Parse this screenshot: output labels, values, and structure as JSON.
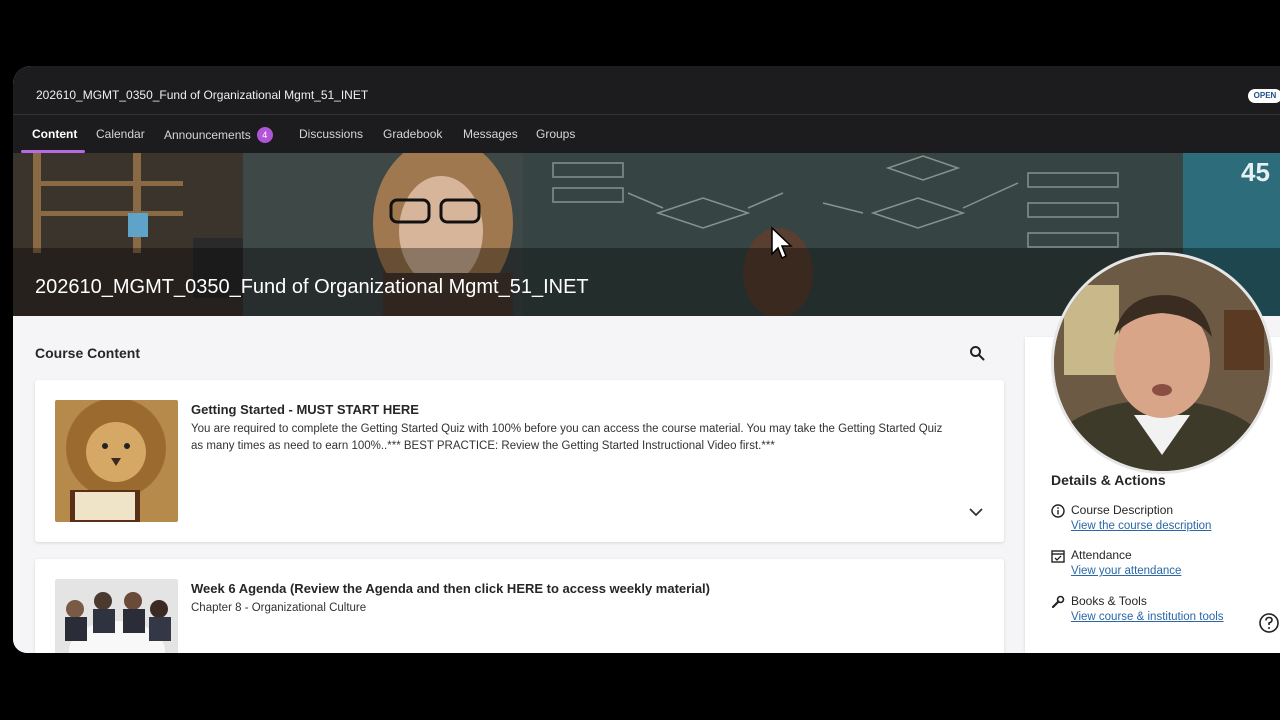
{
  "course": {
    "code": "202610_MGMT_0350_Fund of Organizational Mgmt_51_INET",
    "status_badge": "OPEN",
    "banner_title": "202610_MGMT_0350_Fund of Organizational Mgmt_51_INET"
  },
  "nav": {
    "tabs": [
      {
        "label": "Content",
        "active": true
      },
      {
        "label": "Calendar"
      },
      {
        "label": "Announcements",
        "badge": "4"
      },
      {
        "label": "Discussions"
      },
      {
        "label": "Gradebook"
      },
      {
        "label": "Messages"
      },
      {
        "label": "Groups"
      }
    ]
  },
  "main": {
    "heading": "Course Content",
    "items": [
      {
        "title": "Getting Started - MUST START HERE",
        "description": "You are required to complete the Getting Started Quiz with 100% before you can access the course material. You may take the Getting Started Quiz as many times as need to earn 100%..*** BEST PRACTICE: Review the Getting Started Instructional Video first.***",
        "thumb_icon": "lion-reading-book-image"
      },
      {
        "title": "Week 6 Agenda (Review the Agenda and then click HERE to access weekly material)",
        "description": "Chapter 8 - Organizational Culture",
        "thumb_icon": "business-meeting-image"
      }
    ]
  },
  "sidebar": {
    "heading": "Details & Actions",
    "rows": [
      {
        "label": "Course Description",
        "link": "View the course description",
        "icon": "info-icon"
      },
      {
        "label": "Attendance",
        "link": "View your attendance",
        "icon": "calendar-check-icon"
      },
      {
        "label": "Books & Tools",
        "link": "View course & institution tools",
        "icon": "wrench-icon"
      }
    ]
  },
  "colors": {
    "accent": "#b66bdf",
    "link": "#2a67a6",
    "header_bg": "#1c1c1e"
  }
}
